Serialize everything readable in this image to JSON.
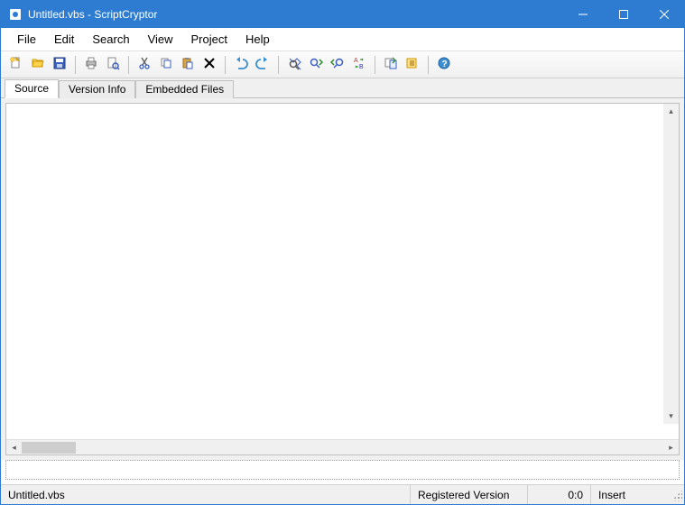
{
  "title": "Untitled.vbs - ScriptCryptor",
  "menu": {
    "file": "File",
    "edit": "Edit",
    "search": "Search",
    "view": "View",
    "project": "Project",
    "help": "Help"
  },
  "toolbar_icons": {
    "new": "new-file-icon",
    "open": "open-folder-icon",
    "save": "save-icon",
    "print": "print-icon",
    "print_preview": "print-preview-icon",
    "cut": "cut-icon",
    "copy": "copy-icon",
    "paste": "paste-icon",
    "delete": "delete-icon",
    "undo": "undo-icon",
    "redo": "redo-icon",
    "find": "find-icon",
    "find_next": "find-next-icon",
    "find_prev": "find-prev-icon",
    "replace": "replace-icon",
    "compile": "compile-icon",
    "settings": "settings-icon",
    "help": "help-icon"
  },
  "tabs": {
    "source": "Source",
    "version_info": "Version Info",
    "embedded_files": "Embedded Files"
  },
  "status": {
    "filename": "Untitled.vbs",
    "version": "Registered Version",
    "position": "0:0",
    "mode": "Insert"
  },
  "colors": {
    "titlebar": "#2e7cd1"
  }
}
